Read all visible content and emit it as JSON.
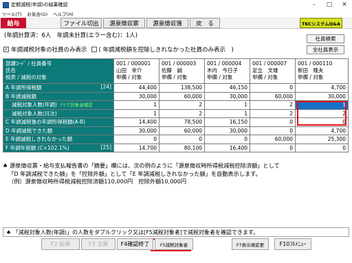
{
  "window": {
    "title": "定額減税(年調)の結果確認"
  },
  "menu": {
    "items": [
      "ツール(T)",
      "お気合(G)",
      "ヘルプ(H)"
    ]
  },
  "toolbar": {
    "badge": "給与",
    "buttons": [
      "ファイル切出",
      "源泉徴収票",
      "源泉徴収簿",
      "戻　る"
    ],
    "logo": "TKCシステムQ&A"
  },
  "summary": {
    "text": "(年調計算済：6人　年調未計算(エラー含む)：1人)"
  },
  "filters": {
    "checked_label": "年調減税対象の社員のみ表示",
    "unchecked_label": "( 年調減税額を控除しきれなかった社員のみ表示　)"
  },
  "side_buttons": {
    "search": "社員検索",
    "show_all": "全社員表示"
  },
  "grid": {
    "header_label_lines": [
      "部課ｺｰﾄﾞ / 社員番号",
      "氏名",
      "税表 / 減税の対象"
    ],
    "employees": [
      {
        "code": "001 / 000001",
        "name": "山田　幸介",
        "type": "甲欄 / 対象"
      },
      {
        "code": "001 / 000003",
        "name": "佐藤　誠",
        "type": "甲欄 / 対象"
      },
      {
        "code": "001 / 000004",
        "name": "木内　今日子",
        "type": "甲欄 / 対象"
      },
      {
        "code": "001 / 000007",
        "name": "足立　文雄",
        "type": "甲欄 / 対象"
      },
      {
        "code": "001 / 000110",
        "name": "新田　隆夫",
        "type": "甲欄 / 対象"
      }
    ],
    "rows": [
      {
        "label": "A 年調所得税額",
        "index": "[24]",
        "note": "",
        "values": [
          "44,400",
          "138,500",
          "46,150",
          "0",
          "4,700"
        ]
      },
      {
        "label": "B 年調減税額",
        "index": "",
        "note": "",
        "values": [
          "30,000",
          "60,000",
          "30,000",
          "60,000",
          "30,000"
        ]
      },
      {
        "label": "減税対象人数(年調)",
        "index": "",
        "note": "F5で対象者確認",
        "values": [
          "1",
          "2",
          "1",
          "2",
          "1"
        ]
      },
      {
        "label": "減税対象人数(月次)",
        "index": "",
        "note": "",
        "values": [
          "1",
          "2",
          "1",
          "2",
          "2"
        ]
      },
      {
        "label": "C 年調減税後の年調所得税額(A-B)",
        "index": "",
        "note": "",
        "values": [
          "14,400",
          "78,500",
          "16,150",
          "0",
          "0"
        ]
      },
      {
        "label": "D 年調減税できた額",
        "index": "",
        "note": "",
        "values": [
          "30,000",
          "60,000",
          "30,000",
          "0",
          "4,700"
        ]
      },
      {
        "label": "E 年調減税しきれなかった額",
        "index": "",
        "note": "",
        "values": [
          "0",
          "0",
          "0",
          "60,000",
          "25,300"
        ]
      },
      {
        "label": "F 年調年税額 (C×102.1%)",
        "index": "[25]",
        "note": "",
        "values": [
          "14,700",
          "80,100",
          "16,400",
          "0",
          "0"
        ]
      }
    ]
  },
  "description": {
    "lines": [
      "♠ 源泉徴収票・給与支払報告書の「摘要」欄には、次の例のように「源泉徴収時所得税減税控除済額」として",
      "「D 年調減税できた額」を「控除外額」として「E 年調減税しきれなかった額」を自動表示します。",
      "（例）源泉徴収時所得税減税控除済額110,000円　控除外額10,000円"
    ]
  },
  "status": {
    "text": "♠ 「減税対象人数(年調)」の人数をダブルクリック又は[F5減税対象者]で減税対象者を確認できます。"
  },
  "fkeys": [
    "F2 前頁",
    "F3 次頁",
    "F4確認終了",
    "F5減税対象者",
    "F7表示順変更",
    "F10ﾌﾙﾒﾆｭｰ"
  ],
  "colors": {
    "accent_teal": "#0c7a79",
    "selected_blue": "#1672c7",
    "highlight_red": "#e0101a",
    "badge_red": "#c8102e"
  }
}
